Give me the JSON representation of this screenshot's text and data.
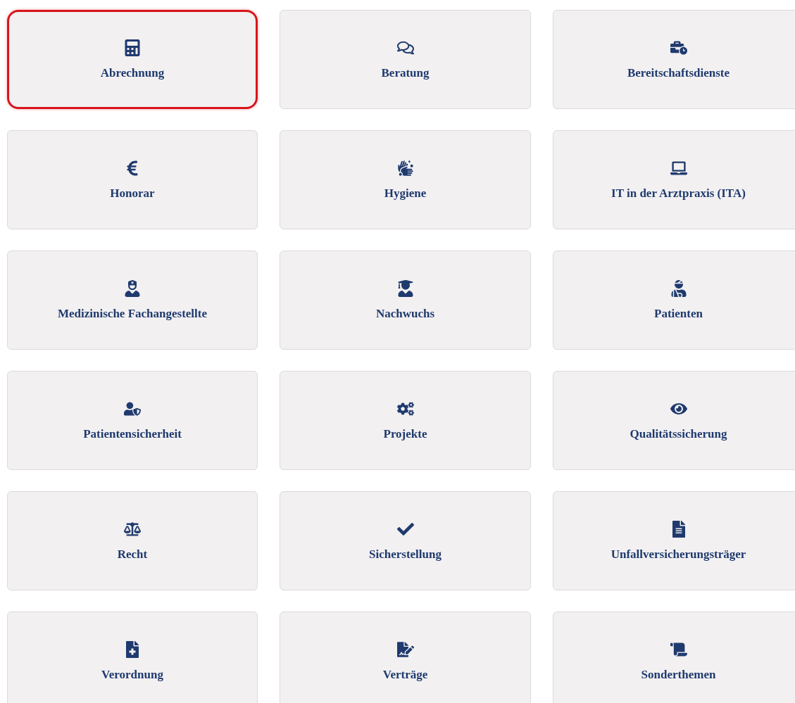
{
  "tiles": [
    {
      "label": "Abrechnung",
      "selected": true
    },
    {
      "label": "Beratung",
      "selected": false
    },
    {
      "label": "Bereitschaftsdienste",
      "selected": false
    },
    {
      "label": "Honorar",
      "selected": false
    },
    {
      "label": "Hygiene",
      "selected": false
    },
    {
      "label": "IT in der Arztpraxis (ITA)",
      "selected": false
    },
    {
      "label": "Medizinische Fachangestellte",
      "selected": false
    },
    {
      "label": "Nachwuchs",
      "selected": false
    },
    {
      "label": "Patienten",
      "selected": false
    },
    {
      "label": "Patientensicherheit",
      "selected": false
    },
    {
      "label": "Projekte",
      "selected": false
    },
    {
      "label": "Qualitätssicherung",
      "selected": false
    },
    {
      "label": "Recht",
      "selected": false
    },
    {
      "label": "Sicherstellung",
      "selected": false
    },
    {
      "label": "Unfallversicherungsträger",
      "selected": false
    },
    {
      "label": "Verordnung",
      "selected": false
    },
    {
      "label": "Verträge",
      "selected": false
    },
    {
      "label": "Sonderthemen",
      "selected": false
    }
  ]
}
